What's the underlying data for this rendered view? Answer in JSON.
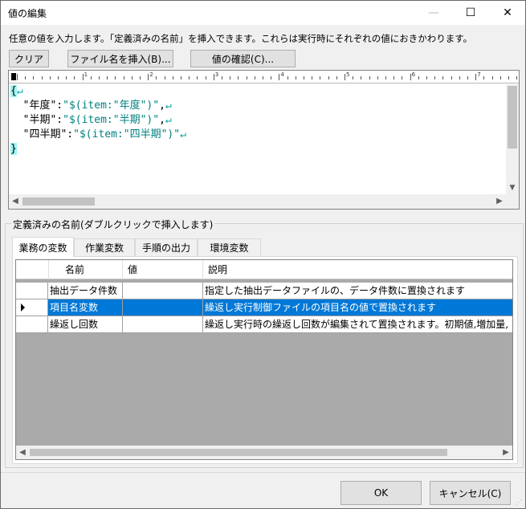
{
  "window": {
    "title": "値の編集",
    "minimize_glyph": "—",
    "maximize_glyph": "☐",
    "close_glyph": "✕"
  },
  "instruction": "任意の値を入力します。「定義済みの名前」を挿入できます。これらは実行時にそれぞれの値におきかわります。",
  "toolbar": {
    "clear_label": "クリア",
    "insert_file_label": "ファイル名を挿入(B)...",
    "check_value_label": "値の確認(C)..."
  },
  "ruler": {
    "numbers": [
      "1",
      "2",
      "3",
      "4",
      "5",
      "6",
      "7"
    ]
  },
  "editor": {
    "lines": [
      {
        "text": "{",
        "type": "brace"
      },
      {
        "key": "  \"年度\":",
        "value": "\"$(item:\"年度\")\"",
        "tail": ","
      },
      {
        "key": "  \"半期\":",
        "value": "\"$(item:\"半期\")\"",
        "tail": ","
      },
      {
        "key": "  \"四半期\":",
        "value": "\"$(item:\"四半期\")\"",
        "tail": ""
      },
      {
        "text": "}",
        "type": "brace"
      }
    ],
    "return_glyph": "↵"
  },
  "defined_names": {
    "group_label": "定義済みの名前(ダブルクリックで挿入します)",
    "tabs": [
      {
        "label": "業務の変数",
        "active": true
      },
      {
        "label": "作業変数",
        "active": false
      },
      {
        "label": "手順の出力",
        "active": false
      },
      {
        "label": "環境変数",
        "active": false
      }
    ],
    "columns": [
      "名前",
      "値",
      "説明"
    ],
    "rows": [
      {
        "name": "抽出データ件数",
        "value": "",
        "description": "指定した抽出データファイルの、データ件数に置換されます",
        "selected": false
      },
      {
        "name": "項目名変数",
        "value": "",
        "description": "繰返し実行制御ファイルの項目名の値で置換されます",
        "selected": true
      },
      {
        "name": "繰返し回数",
        "value": "",
        "description": "繰返し実行時の繰返し回数が編集されて置換されます。初期値,増加量,",
        "selected": false
      }
    ]
  },
  "footer": {
    "ok_label": "OK",
    "cancel_label": "キャンセル(C)"
  }
}
